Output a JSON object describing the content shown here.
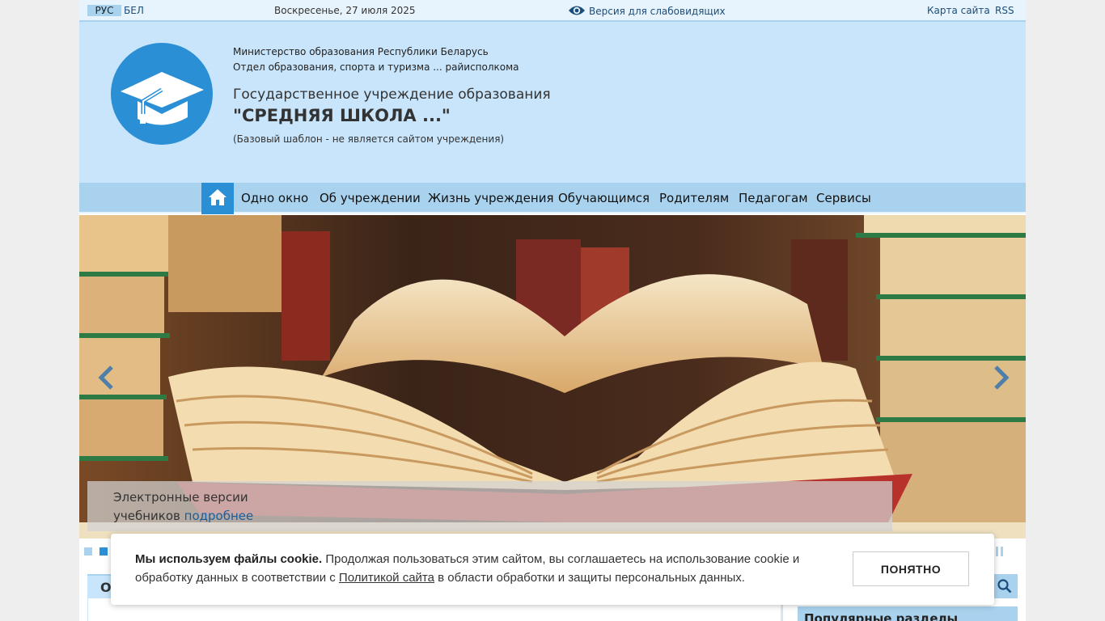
{
  "topbar": {
    "lang_rus": "РУС",
    "lang_bel": "БЕЛ",
    "date": "Воскресенье, 27 июля 2025",
    "vision_label": "Версия для слабовидящих",
    "sitemap_label": "Карта сайта",
    "rss_label": "RSS"
  },
  "header": {
    "ministry": "Министерство образования Республики Беларусь",
    "department": "Отдел образования, спорта и туризма ... райисполкома",
    "institution_type": "Государственное учреждение образования",
    "school_name": "\"СРЕДНЯЯ ШКОЛА ...\"",
    "note": "(Базовый шаблон - не является сайтом учреждения)",
    "logo_icon": "graduation-cap-icon"
  },
  "nav": {
    "home_icon": "home-icon",
    "items": [
      "Одно окно",
      "Об учреждении",
      "Жизнь учреждения",
      "Обучающимся",
      "Родителям",
      "Педагогам",
      "Сервисы"
    ]
  },
  "slider": {
    "caption_line1": "Электронные версии",
    "caption_line2": "учебников",
    "caption_link": "подробнее"
  },
  "content": {
    "main_block_title_letter": "О",
    "popular_title": "Популярные разделы"
  },
  "cookie": {
    "strong": "Мы используем файлы cookie.",
    "text_before": " Продолжая пользоваться этим сайтом, вы соглашаетесь на использование cookie и обработку данных в соответствии с ",
    "policy_link": "Политикой сайта",
    "text_after": " в области обработки и защиты персональных данных.",
    "accept_label": "ПОНЯТНО"
  },
  "colors": {
    "accent": "#2b8fd6",
    "header_bg": "#c8e5fb",
    "nav_bg": "#a9d2ee",
    "link": "#1b4d7a"
  }
}
